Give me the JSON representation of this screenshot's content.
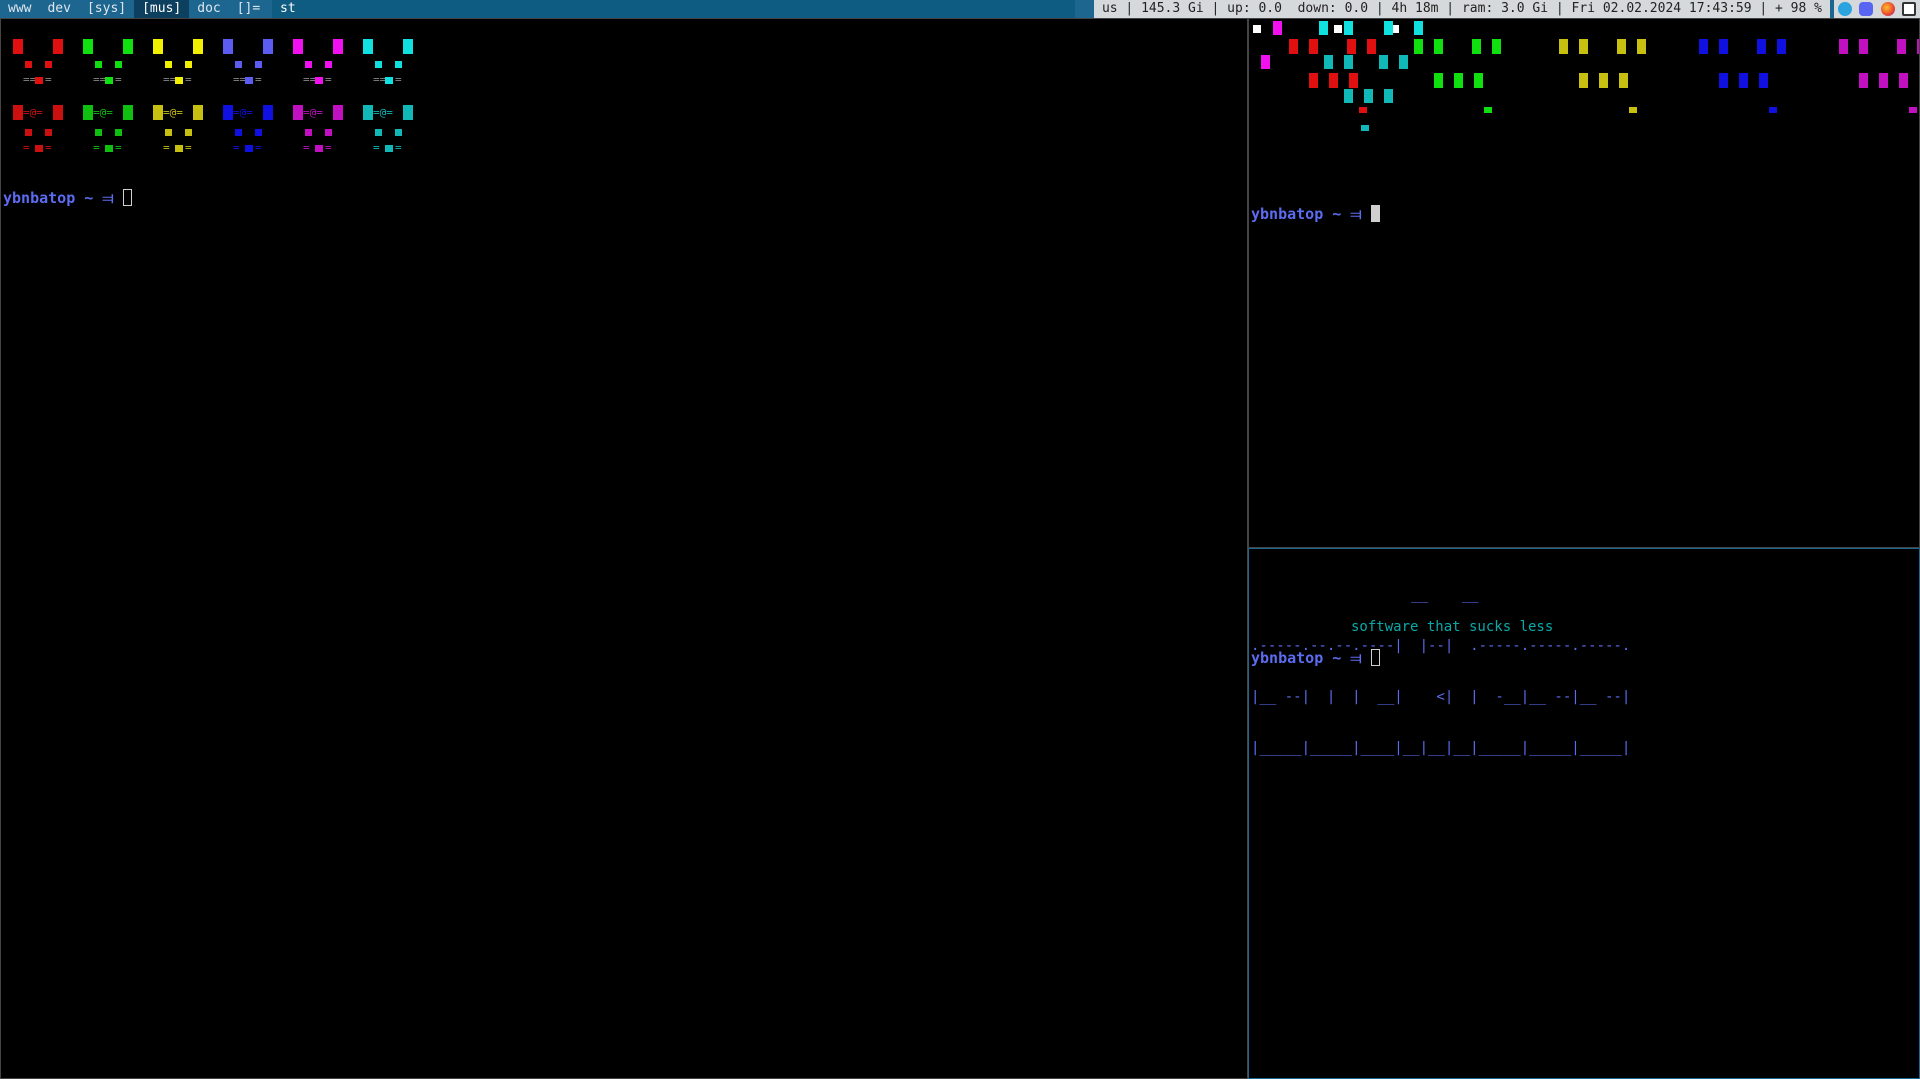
{
  "bar": {
    "tags": [
      "www",
      "dev",
      "[sys]",
      "[mus]",
      "doc"
    ],
    "selected_tag": "[mus]",
    "layout": "[]=",
    "window_title": "st",
    "status": "us | 145.3 Gi | up: 0.0  down: 0.0 | 4h 18m | ram: 3.0 Gi | Fri 02.02.2024 17:43:59 | + 98 %",
    "tray_icons": [
      "telegram-icon",
      "discord-icon",
      "firefox-icon",
      "window-icon"
    ]
  },
  "terminals": {
    "left": {
      "prompt": "ybnbatop ~ ⫤ "
    },
    "right_top": {
      "prompt": "ybnbatop ~ ⫤ "
    },
    "right_bottom": {
      "prompt": "ybnbatop ~ ⫤ ",
      "banner": [
        "                   __    __",
        ".-----.--.--.----|  |--|  .-----.-----.-----.",
        "|__ --|  |  |  __|    <|  |  -__|__ --|__ --|",
        "|_____|_____|____|__|__|__|_____|_____|_____|"
      ],
      "tagline": "software that sucks less"
    }
  },
  "colors": {
    "red": "#e01010",
    "green": "#10e010",
    "yellow": "#f0f000",
    "blue": "#5c5cf0",
    "magenta": "#f010f0",
    "cyan": "#10e0e0",
    "dark_red": "#cc1010",
    "dark_green": "#10c010",
    "dark_yellow": "#c8c010",
    "dark_blue": "#1010e0",
    "dark_magenta": "#c010c0",
    "dark_cyan": "#10b8b8",
    "prompt": "#5c6cf0"
  }
}
